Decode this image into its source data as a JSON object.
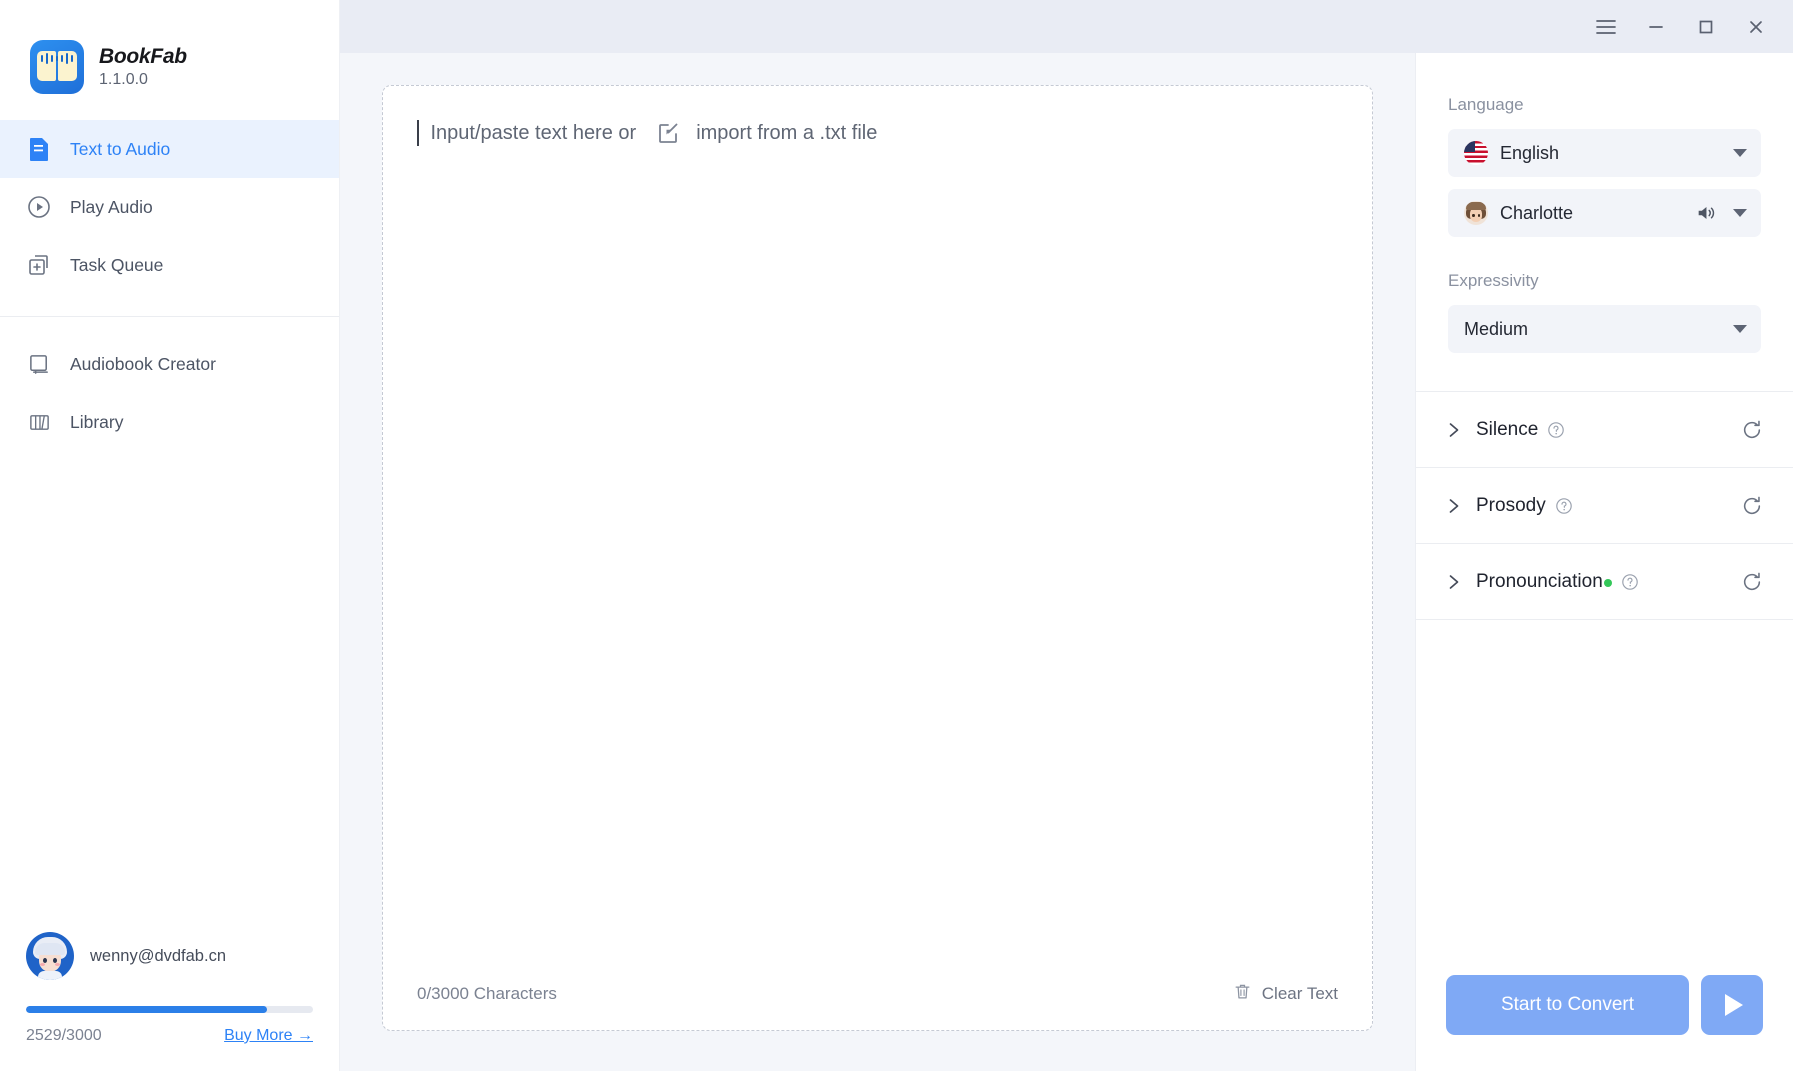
{
  "brand": {
    "name": "BookFab",
    "version": "1.1.0.0",
    "logo_icon": "book-audio-logo-icon"
  },
  "sidebar": {
    "items": [
      {
        "label": "Text to Audio",
        "icon": "document-text-icon",
        "active": true
      },
      {
        "label": "Play Audio",
        "icon": "play-circle-icon",
        "active": false
      },
      {
        "label": "Task Queue",
        "icon": "stacked-plus-icon",
        "active": false
      },
      {
        "label": "Audiobook Creator",
        "icon": "book-icon",
        "active": false
      },
      {
        "label": "Library",
        "icon": "bookshelf-icon",
        "active": false
      }
    ],
    "user": {
      "email": "wenny@dvdfab.cn",
      "avatar_icon": "user-avatar",
      "quota_text": "2529/3000",
      "quota_used": 2529,
      "quota_total": 3000,
      "quota_percent": 84,
      "buy_more_label": "Buy More →"
    }
  },
  "titlebar": {
    "menu_icon": "hamburger-menu-icon",
    "minimize_icon": "minimize-icon",
    "maximize_icon": "maximize-icon",
    "close_icon": "close-icon"
  },
  "editor": {
    "placeholder_prefix": "Input/paste text here or",
    "import_icon": "import-file-icon",
    "import_label": "import from a .txt file",
    "char_count": "0/3000 Characters",
    "clear_icon": "trash-icon",
    "clear_label": "Clear Text"
  },
  "settings": {
    "language_label": "Language",
    "language_value": "English",
    "language_flag_icon": "us-flag-icon",
    "language_caret_icon": "chevron-down-icon",
    "voice_value": "Charlotte",
    "voice_avatar_icon": "voice-avatar-icon",
    "voice_speaker_icon": "speaker-icon",
    "voice_caret_icon": "chevron-down-icon",
    "expressivity_label": "Expressivity",
    "expressivity_value": "Medium",
    "expressivity_caret_icon": "chevron-down-icon",
    "accordions": [
      {
        "label": "Silence",
        "expanded": false,
        "badge": false,
        "help_icon": "help-circle-icon",
        "reset_icon": "refresh-icon",
        "chevron_icon": "chevron-right-icon"
      },
      {
        "label": "Prosody",
        "expanded": false,
        "badge": false,
        "help_icon": "help-circle-icon",
        "reset_icon": "refresh-icon",
        "chevron_icon": "chevron-right-icon"
      },
      {
        "label": "Pronounciation",
        "expanded": false,
        "badge": true,
        "help_icon": "help-circle-icon",
        "reset_icon": "refresh-icon",
        "chevron_icon": "chevron-right-icon"
      }
    ]
  },
  "actions": {
    "convert_label": "Start to Convert",
    "play_icon": "play-icon"
  },
  "colors": {
    "accent": "#2d82f6",
    "accent_muted": "#7fa9f5",
    "active_bg": "#eaf2fe",
    "titlebar_bg": "#e9ecf4",
    "canvas_bg": "#f4f6fa",
    "badge_green": "#34c759"
  }
}
